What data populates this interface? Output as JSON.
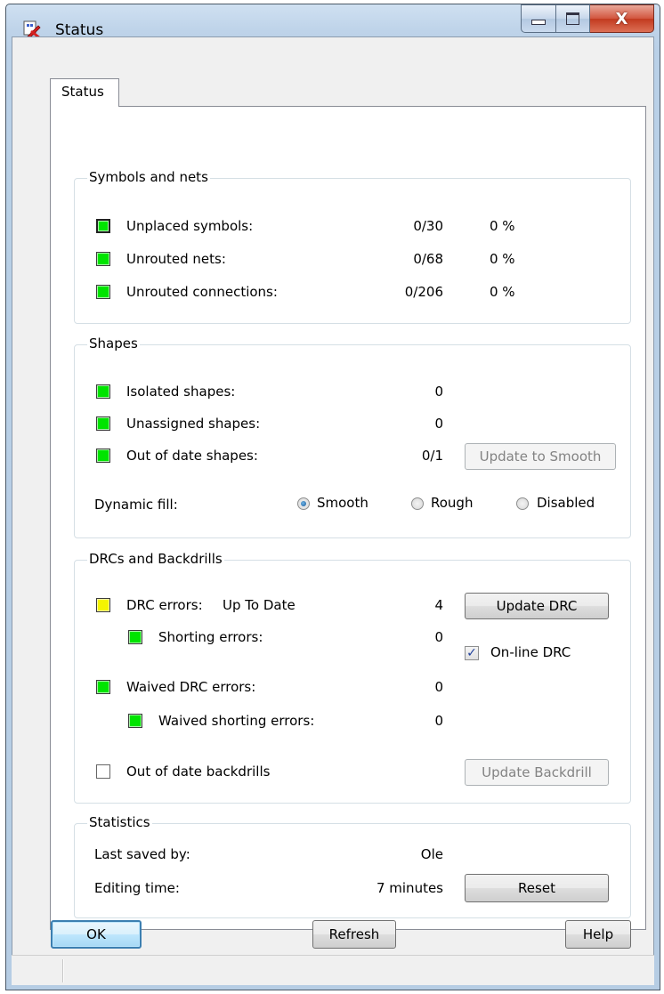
{
  "window": {
    "title": "Status"
  },
  "tabs": [
    {
      "label": "Status"
    }
  ],
  "symbols_nets": {
    "title": "Symbols and nets",
    "rows": [
      {
        "label": "Unplaced symbols:",
        "count": "0/30",
        "percent": "0 %"
      },
      {
        "label": "Unrouted nets:",
        "count": "0/68",
        "percent": "0 %"
      },
      {
        "label": "Unrouted connections:",
        "count": "0/206",
        "percent": "0 %"
      }
    ]
  },
  "shapes": {
    "title": "Shapes",
    "rows": [
      {
        "label": "Isolated shapes:",
        "count": "0"
      },
      {
        "label": "Unassigned shapes:",
        "count": "0"
      },
      {
        "label": "Out of date shapes:",
        "count": "0/1"
      }
    ],
    "update_button": "Update to Smooth",
    "dynamic_fill_label": "Dynamic fill:",
    "fill_options": [
      "Smooth",
      "Rough",
      "Disabled"
    ],
    "fill_selected": "Smooth"
  },
  "drc": {
    "title": "DRCs and Backdrills",
    "drc_errors_label": "DRC errors:",
    "drc_status": "Up To Date",
    "drc_errors_count": "4",
    "update_drc_button": "Update DRC",
    "shorting_label": "Shorting errors:",
    "shorting_count": "0",
    "online_drc_label": "On-line DRC",
    "online_drc_checked": true,
    "waived_label": "Waived DRC errors:",
    "waived_count": "0",
    "waived_shorting_label": "Waived shorting errors:",
    "waived_shorting_count": "0",
    "backdrills_label": "Out of date backdrills",
    "update_backdrill_button": "Update Backdrill"
  },
  "statistics": {
    "title": "Statistics",
    "last_saved_label": "Last saved by:",
    "last_saved_value": "Ole",
    "editing_time_label": "Editing time:",
    "editing_time_value": "7 minutes",
    "reset_button": "Reset"
  },
  "footer": {
    "ok": "OK",
    "refresh": "Refresh",
    "help": "Help"
  },
  "colors": {
    "ok_indicator": "#00e400",
    "warning_indicator": "#f5f500",
    "title_bar": "#bed3e9"
  }
}
